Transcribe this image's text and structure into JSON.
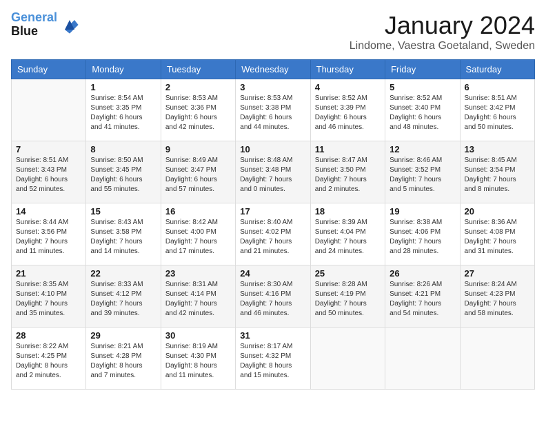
{
  "logo": {
    "line1": "General",
    "line2": "Blue"
  },
  "title": "January 2024",
  "location": "Lindome, Vaestra Goetaland, Sweden",
  "days_of_week": [
    "Sunday",
    "Monday",
    "Tuesday",
    "Wednesday",
    "Thursday",
    "Friday",
    "Saturday"
  ],
  "weeks": [
    [
      {
        "day": "",
        "info": ""
      },
      {
        "day": "1",
        "info": "Sunrise: 8:54 AM\nSunset: 3:35 PM\nDaylight: 6 hours\nand 41 minutes."
      },
      {
        "day": "2",
        "info": "Sunrise: 8:53 AM\nSunset: 3:36 PM\nDaylight: 6 hours\nand 42 minutes."
      },
      {
        "day": "3",
        "info": "Sunrise: 8:53 AM\nSunset: 3:38 PM\nDaylight: 6 hours\nand 44 minutes."
      },
      {
        "day": "4",
        "info": "Sunrise: 8:52 AM\nSunset: 3:39 PM\nDaylight: 6 hours\nand 46 minutes."
      },
      {
        "day": "5",
        "info": "Sunrise: 8:52 AM\nSunset: 3:40 PM\nDaylight: 6 hours\nand 48 minutes."
      },
      {
        "day": "6",
        "info": "Sunrise: 8:51 AM\nSunset: 3:42 PM\nDaylight: 6 hours\nand 50 minutes."
      }
    ],
    [
      {
        "day": "7",
        "info": "Sunrise: 8:51 AM\nSunset: 3:43 PM\nDaylight: 6 hours\nand 52 minutes."
      },
      {
        "day": "8",
        "info": "Sunrise: 8:50 AM\nSunset: 3:45 PM\nDaylight: 6 hours\nand 55 minutes."
      },
      {
        "day": "9",
        "info": "Sunrise: 8:49 AM\nSunset: 3:47 PM\nDaylight: 6 hours\nand 57 minutes."
      },
      {
        "day": "10",
        "info": "Sunrise: 8:48 AM\nSunset: 3:48 PM\nDaylight: 7 hours\nand 0 minutes."
      },
      {
        "day": "11",
        "info": "Sunrise: 8:47 AM\nSunset: 3:50 PM\nDaylight: 7 hours\nand 2 minutes."
      },
      {
        "day": "12",
        "info": "Sunrise: 8:46 AM\nSunset: 3:52 PM\nDaylight: 7 hours\nand 5 minutes."
      },
      {
        "day": "13",
        "info": "Sunrise: 8:45 AM\nSunset: 3:54 PM\nDaylight: 7 hours\nand 8 minutes."
      }
    ],
    [
      {
        "day": "14",
        "info": "Sunrise: 8:44 AM\nSunset: 3:56 PM\nDaylight: 7 hours\nand 11 minutes."
      },
      {
        "day": "15",
        "info": "Sunrise: 8:43 AM\nSunset: 3:58 PM\nDaylight: 7 hours\nand 14 minutes."
      },
      {
        "day": "16",
        "info": "Sunrise: 8:42 AM\nSunset: 4:00 PM\nDaylight: 7 hours\nand 17 minutes."
      },
      {
        "day": "17",
        "info": "Sunrise: 8:40 AM\nSunset: 4:02 PM\nDaylight: 7 hours\nand 21 minutes."
      },
      {
        "day": "18",
        "info": "Sunrise: 8:39 AM\nSunset: 4:04 PM\nDaylight: 7 hours\nand 24 minutes."
      },
      {
        "day": "19",
        "info": "Sunrise: 8:38 AM\nSunset: 4:06 PM\nDaylight: 7 hours\nand 28 minutes."
      },
      {
        "day": "20",
        "info": "Sunrise: 8:36 AM\nSunset: 4:08 PM\nDaylight: 7 hours\nand 31 minutes."
      }
    ],
    [
      {
        "day": "21",
        "info": "Sunrise: 8:35 AM\nSunset: 4:10 PM\nDaylight: 7 hours\nand 35 minutes."
      },
      {
        "day": "22",
        "info": "Sunrise: 8:33 AM\nSunset: 4:12 PM\nDaylight: 7 hours\nand 39 minutes."
      },
      {
        "day": "23",
        "info": "Sunrise: 8:31 AM\nSunset: 4:14 PM\nDaylight: 7 hours\nand 42 minutes."
      },
      {
        "day": "24",
        "info": "Sunrise: 8:30 AM\nSunset: 4:16 PM\nDaylight: 7 hours\nand 46 minutes."
      },
      {
        "day": "25",
        "info": "Sunrise: 8:28 AM\nSunset: 4:19 PM\nDaylight: 7 hours\nand 50 minutes."
      },
      {
        "day": "26",
        "info": "Sunrise: 8:26 AM\nSunset: 4:21 PM\nDaylight: 7 hours\nand 54 minutes."
      },
      {
        "day": "27",
        "info": "Sunrise: 8:24 AM\nSunset: 4:23 PM\nDaylight: 7 hours\nand 58 minutes."
      }
    ],
    [
      {
        "day": "28",
        "info": "Sunrise: 8:22 AM\nSunset: 4:25 PM\nDaylight: 8 hours\nand 2 minutes."
      },
      {
        "day": "29",
        "info": "Sunrise: 8:21 AM\nSunset: 4:28 PM\nDaylight: 8 hours\nand 7 minutes."
      },
      {
        "day": "30",
        "info": "Sunrise: 8:19 AM\nSunset: 4:30 PM\nDaylight: 8 hours\nand 11 minutes."
      },
      {
        "day": "31",
        "info": "Sunrise: 8:17 AM\nSunset: 4:32 PM\nDaylight: 8 hours\nand 15 minutes."
      },
      {
        "day": "",
        "info": ""
      },
      {
        "day": "",
        "info": ""
      },
      {
        "day": "",
        "info": ""
      }
    ]
  ]
}
